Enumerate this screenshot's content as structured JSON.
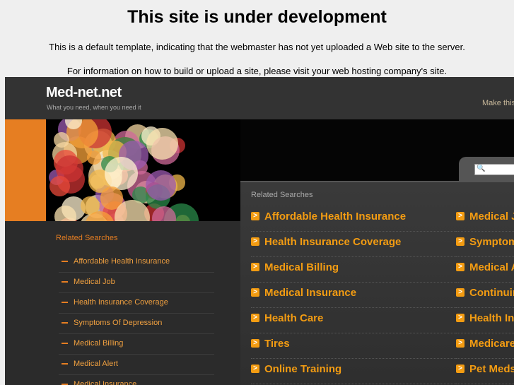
{
  "notice": {
    "title": "This site is under development",
    "line1": "This is a default template, indicating that the webmaster has not yet uploaded a Web site to the server.",
    "line2": "For information on how to build or upload a site, please visit your web hosting company's site."
  },
  "site": {
    "name": "Med-net.net",
    "tagline": "What you need, when you need it",
    "make_link": "Make this"
  },
  "main": {
    "heading": "Related Searches",
    "left": [
      "Affordable Health Insurance",
      "Health Insurance Coverage",
      "Medical Billing",
      "Medical Insurance",
      "Health Care",
      "Tires",
      "Online Training"
    ],
    "right": [
      "Medical J",
      "Symptom",
      "Medical A",
      "Continuin",
      "Health Ins",
      "Medicare",
      "Pet Meds"
    ]
  },
  "sidebar": {
    "heading": "Related Searches",
    "items": [
      "Affordable Health Insurance",
      "Medical Job",
      "Health Insurance Coverage",
      "Symptoms Of Depression",
      "Medical Billing",
      "Medical Alert",
      "Medical Insurance"
    ]
  },
  "colors": {
    "accent": "#e67e22",
    "link": "#f39c12"
  }
}
